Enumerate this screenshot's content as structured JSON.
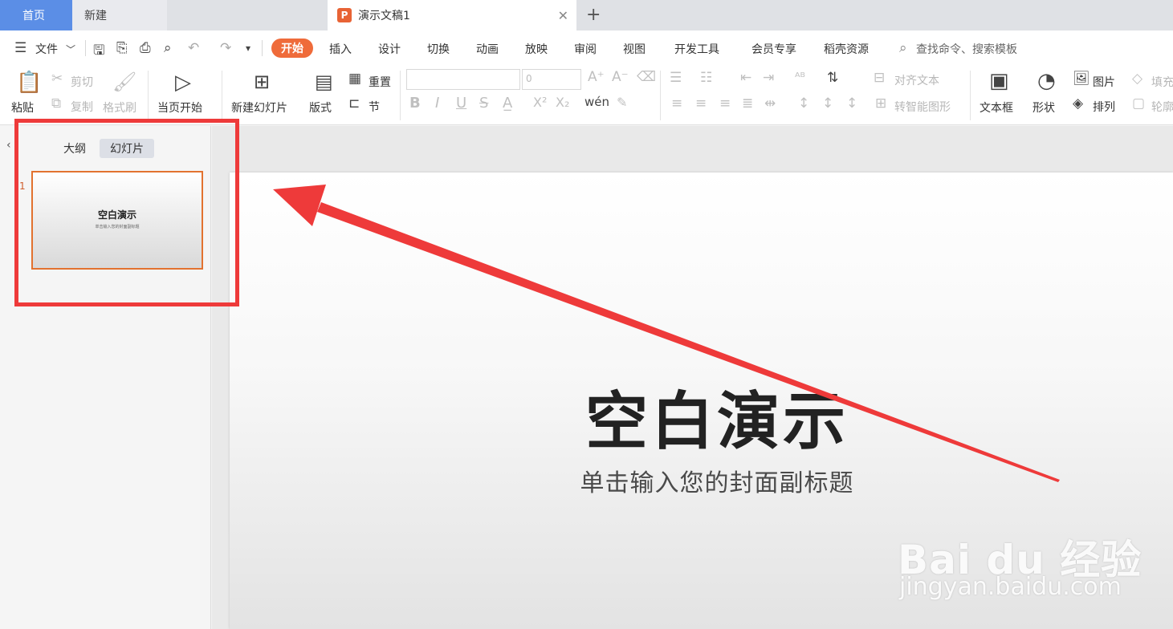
{
  "tabs": {
    "home": "首页",
    "new": "新建",
    "doc": "演示文稿1",
    "doc_icon": "P",
    "close_glyph": "✕",
    "add_glyph": "+"
  },
  "menu": {
    "file": "文件",
    "items": [
      "开始",
      "插入",
      "设计",
      "切换",
      "动画",
      "放映",
      "审阅",
      "视图",
      "开发工具",
      "会员专享",
      "稻壳资源"
    ],
    "active_index": 0,
    "search": "查找命令、搜索模板"
  },
  "ribbon": {
    "paste": "粘贴",
    "cut": "剪切",
    "copy": "复制",
    "format_painter": "格式刷",
    "start_from_current": "当页开始",
    "new_slide": "新建幻灯片",
    "layout": "版式",
    "reset": "重置",
    "section": "节",
    "font_size": "0",
    "align_text": "对齐文本",
    "smart_shape": "转智能图形",
    "text_box": "文本框",
    "shape": "形状",
    "picture": "图片",
    "arrange": "排列",
    "fill": "填充",
    "outline": "轮廓"
  },
  "panel": {
    "outline_tab": "大纲",
    "slides_tab": "幻灯片",
    "slide_number": "1",
    "thumb_title": "空白演示",
    "thumb_subtitle": "单击输入您的封面副标题"
  },
  "slide": {
    "title": "空白演示",
    "subtitle": "单击输入您的封面副标题"
  },
  "watermark": {
    "brand": "Bai du 经验",
    "url": "jingyan.baidu.com"
  },
  "colors": {
    "accent": "#ef6b3a",
    "annotation": "#ee3a3a",
    "home_tab": "#5b8ee6"
  }
}
